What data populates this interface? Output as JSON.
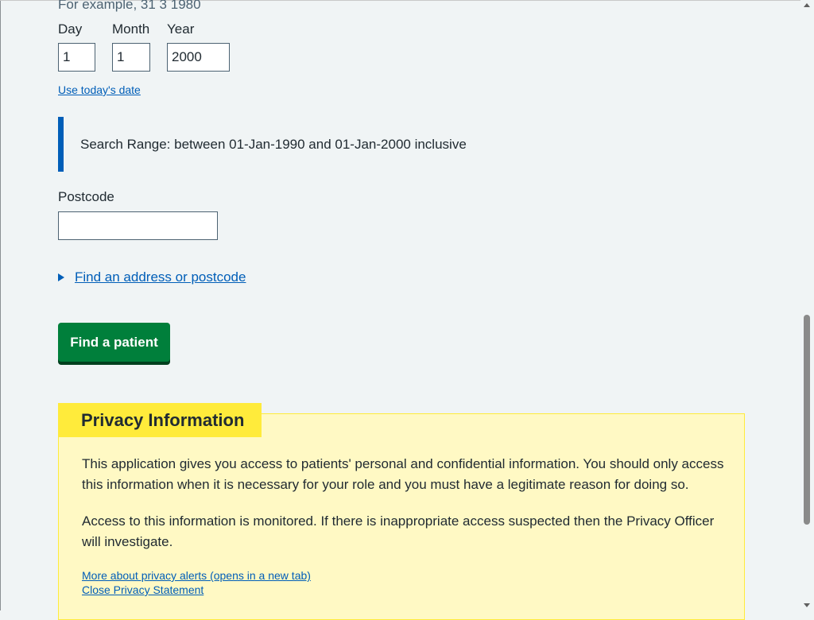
{
  "dob": {
    "hint": "For example, 31 3 1980",
    "day_label": "Day",
    "month_label": "Month",
    "year_label": "Year",
    "day_value": "1",
    "month_value": "1",
    "year_value": "2000",
    "today_link": "Use today's date"
  },
  "search_range": {
    "text": "Search Range: between 01-Jan-1990 and 01-Jan-2000 inclusive",
    "accent_color": "#005eb8"
  },
  "postcode": {
    "label": "Postcode",
    "value": ""
  },
  "address_finder": {
    "summary": "Find an address or postcode"
  },
  "actions": {
    "find_patient": "Find a patient",
    "button_color": "#007f3b"
  },
  "privacy": {
    "heading": "Privacy Information",
    "paragraph_1": "This application gives you access to patients' personal and confidential information. You should only access this information when it is necessary for your role and you must have a legitimate reason for doing so.",
    "paragraph_2": "Access to this information is monitored. If there is inappropriate access suspected then the Privacy Officer will investigate.",
    "link_1": "More about privacy alerts (opens in a new tab)",
    "link_2": "Close Privacy Statement",
    "card_color": "#fff9c4",
    "heading_color": "#ffeb3b"
  }
}
